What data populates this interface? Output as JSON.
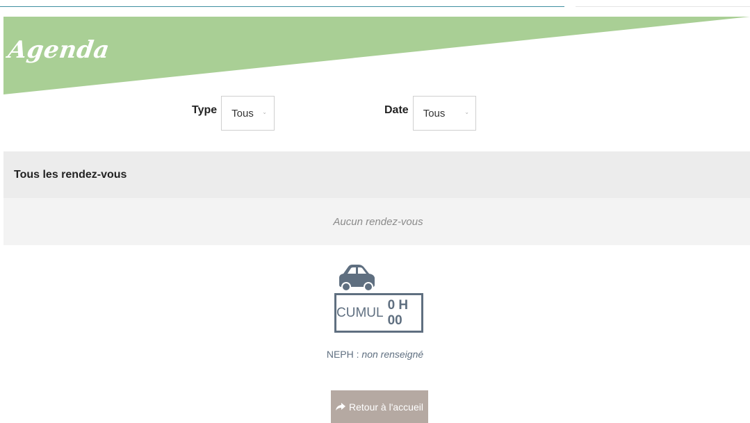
{
  "banner": {
    "title": "Agenda",
    "color": "#a9cf95"
  },
  "filters": {
    "type": {
      "label": "Type",
      "selected": "Tous"
    },
    "date": {
      "label": "Date",
      "selected": "Tous"
    }
  },
  "appointments": {
    "header": "Tous les rendez-vous",
    "empty_message": "Aucun rendez-vous"
  },
  "cumul": {
    "label": "CUMUL",
    "value": "0 H 00",
    "icon": "car-icon"
  },
  "neph": {
    "label": "NEPH :",
    "value": "non renseigné"
  },
  "home_button": {
    "label": "Retour à l'accueil",
    "icon": "share-arrow-icon"
  },
  "colors": {
    "accent_slate": "#5f6f80",
    "button": "#b5a9a2",
    "section_bg": "#ececec"
  }
}
